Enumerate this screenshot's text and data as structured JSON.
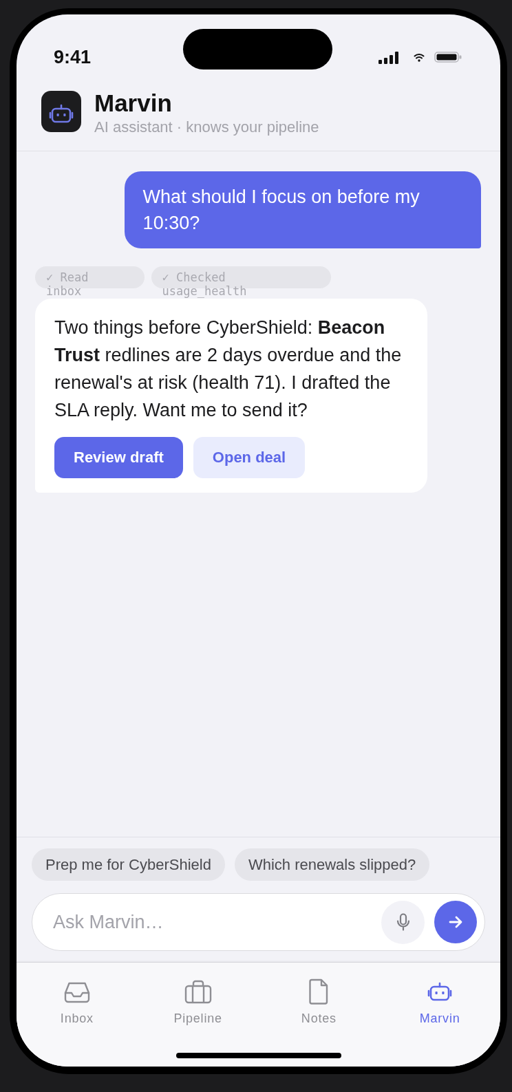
{
  "status_bar": {
    "time": "9:41"
  },
  "header": {
    "title": "Marvin",
    "subtitle": "AI assistant · knows your pipeline"
  },
  "messages": [
    {
      "kind": "user",
      "text": "What should I focus on before my 10:30?"
    },
    {
      "kind": "tool_calls",
      "items": [
        {
          "label": "✓ Read inbox"
        },
        {
          "label": "✓ Checked usage_health"
        }
      ]
    },
    {
      "kind": "assistant",
      "text": "Two things before CyberShield: **Beacon Trust** redlines are 2 days overdue and the renewal's at risk (health 71). I drafted the SLA reply. Want me to send it?",
      "actions": [
        {
          "label": "Review draft",
          "kind": "primary"
        },
        {
          "label": "Open deal",
          "kind": "secondary"
        }
      ]
    }
  ],
  "suggestions": [
    {
      "label": "Prep me for CyberShield"
    },
    {
      "label": "Which renewals slipped?"
    }
  ],
  "composer": {
    "placeholder": "Ask Marvin…"
  },
  "tabs": [
    {
      "label": "Inbox",
      "selected": false
    },
    {
      "label": "Pipeline",
      "selected": false
    },
    {
      "label": "Notes",
      "selected": false
    },
    {
      "label": "Marvin",
      "selected": true
    }
  ]
}
